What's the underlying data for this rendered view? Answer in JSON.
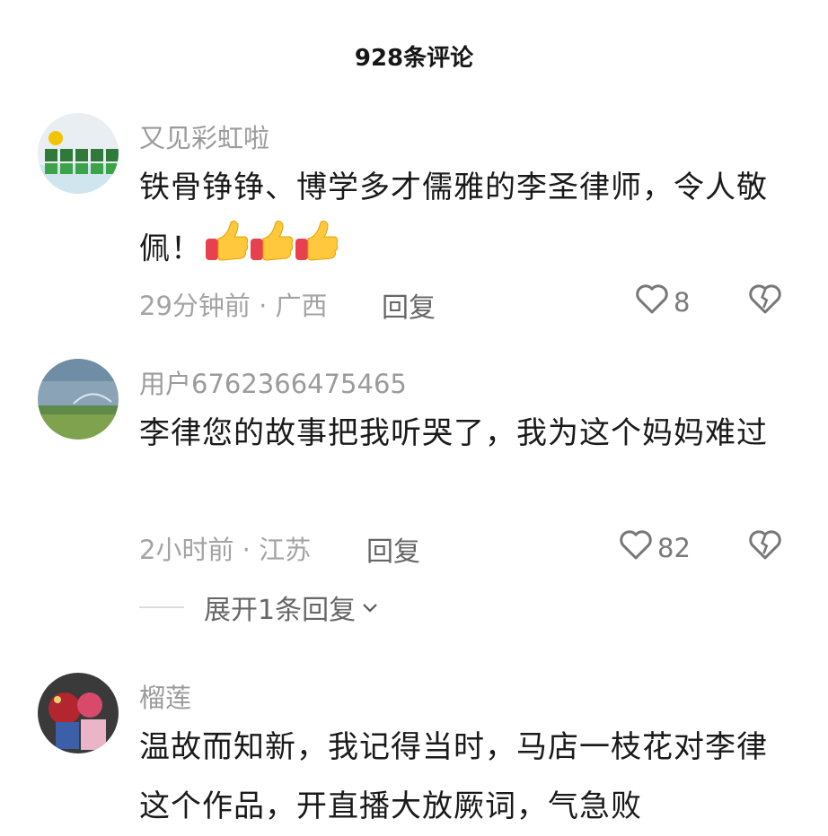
{
  "header": {
    "title": "928条评论"
  },
  "comments": [
    {
      "username": "又见彩虹啦",
      "text": "铁骨铮铮、博学多才儒雅的李圣律师，令人敬佩！",
      "time": "29分钟前 · 广西",
      "reply_label": "回复",
      "likes": "8",
      "emoji": "thumbs-up ×3"
    },
    {
      "username": "用户6762366475465",
      "text": "李律您的故事把我听哭了，我为这个妈妈难过",
      "time": "2小时前 · 江苏",
      "reply_label": "回复",
      "likes": "82",
      "expand_label": "展开1条回复"
    },
    {
      "username": "榴莲",
      "text": "温故而知新，我记得当时，马店一枝花对李律这个作品，开直播大放厥词，气急败"
    }
  ],
  "colors": {
    "username": "#9b9b9b",
    "meta": "#a3a3a3",
    "text": "#1a1a1a"
  },
  "icons": [
    "heart-outline-icon",
    "broken-heart-icon",
    "chevron-down-icon",
    "thumbs-up-emoji"
  ]
}
